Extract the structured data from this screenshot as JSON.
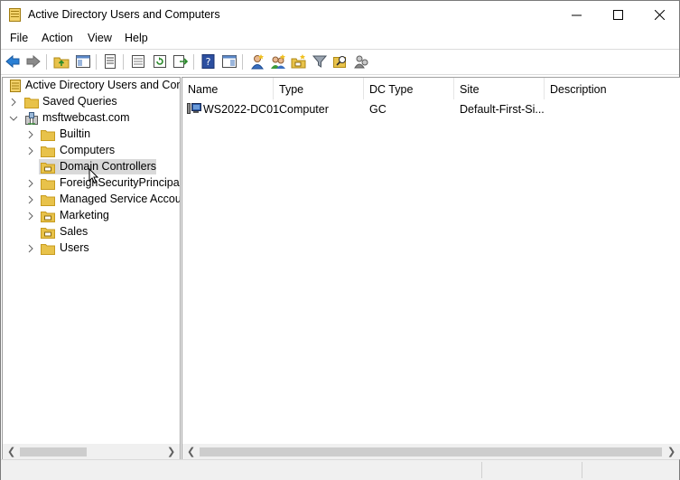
{
  "window": {
    "title": "Active Directory Users and Computers"
  },
  "menu": [
    "File",
    "Action",
    "View",
    "Help"
  ],
  "toolbar": {
    "icons": [
      "back-arrow-icon",
      "forward-arrow-icon",
      "up-folder-icon",
      "show-console-tree-icon",
      "properties-icon",
      "export-list-icon",
      "refresh-icon",
      "export-icon",
      "help-icon",
      "show-action-pane-icon",
      "new-user-icon",
      "new-group-icon",
      "new-ou-icon",
      "filter-icon",
      "find-icon",
      "add-to-group-icon"
    ]
  },
  "tree": {
    "root": "Active Directory Users and Com",
    "saved_queries": "Saved Queries",
    "domain": "msftwebcast.com",
    "children": [
      {
        "label": "Builtin",
        "expandable": true
      },
      {
        "label": "Computers",
        "expandable": true
      },
      {
        "label": "Domain Controllers",
        "expandable": false,
        "selected": true
      },
      {
        "label": "ForeignSecurityPrincipals",
        "expandable": true
      },
      {
        "label": "Managed Service Accour",
        "expandable": true
      },
      {
        "label": "Marketing",
        "expandable": true
      },
      {
        "label": "Sales",
        "expandable": false
      },
      {
        "label": "Users",
        "expandable": true
      }
    ]
  },
  "list": {
    "columns": [
      "Name",
      "Type",
      "DC Type",
      "Site",
      "Description"
    ],
    "rows": [
      {
        "name": "WS2022-DC01",
        "type": "Computer",
        "dc_type": "GC",
        "site": "Default-First-Si...",
        "description": ""
      }
    ]
  },
  "colors": {
    "folder": "#e8c24a",
    "folder_dark": "#c79b1e",
    "selection": "#d9d9d9",
    "accent_blue": "#1f6fc9"
  }
}
